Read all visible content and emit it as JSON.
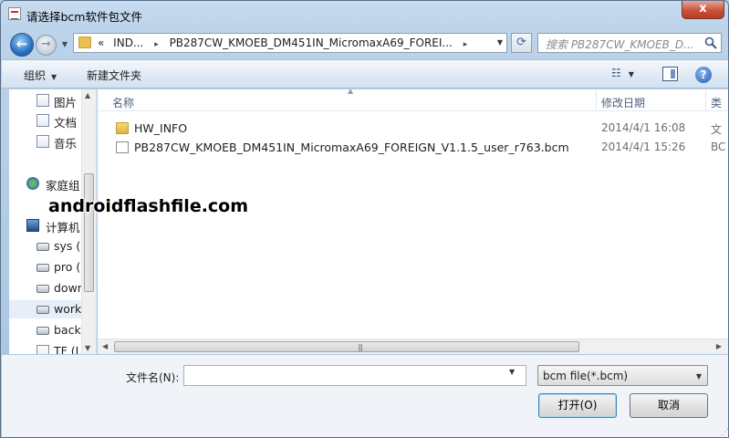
{
  "window": {
    "title": "请选择bcm软件包文件",
    "close_label": "x"
  },
  "nav": {
    "back_symbol": "←",
    "forward_symbol": "→",
    "address": {
      "overflow": "«",
      "segment1": "IND...",
      "segment2": "PB287CW_KMOEB_DM451IN_MicromaxA69_FOREI...",
      "separator": "▸"
    },
    "search_placeholder": "搜索 PB287CW_KMOEB_D..."
  },
  "toolbar": {
    "organize_label": "组织",
    "new_folder_label": "新建文件夹",
    "help_label": "?"
  },
  "sidebar": {
    "items": [
      {
        "label": "图片",
        "icon": "pictures-icon"
      },
      {
        "label": "文档",
        "icon": "documents-icon"
      },
      {
        "label": "音乐",
        "icon": "music-icon"
      },
      {
        "label": "家庭组",
        "icon": "homegroup-icon"
      },
      {
        "label": "计算机",
        "icon": "computer-icon"
      },
      {
        "label": "sys (",
        "icon": "system-drive-icon"
      },
      {
        "label": "pro (",
        "icon": "drive-icon"
      },
      {
        "label": "dowr",
        "icon": "drive-icon"
      },
      {
        "label": "work",
        "icon": "drive-icon"
      },
      {
        "label": "back",
        "icon": "drive-icon"
      },
      {
        "label": "TF (I",
        "icon": "removable-drive-icon"
      }
    ],
    "selected": "work"
  },
  "file_list": {
    "columns": [
      "名称",
      "修改日期",
      "类"
    ],
    "rows": [
      {
        "name": "HW_INFO",
        "date": "2014/4/1 16:08",
        "type": "文",
        "kind": "folder"
      },
      {
        "name": "PB287CW_KMOEB_DM451IN_MicromaxA69_FOREIGN_V1.1.5_user_r763.bcm",
        "date": "2014/4/1 15:26",
        "type": "BC",
        "kind": "file"
      }
    ]
  },
  "watermark": "androidflashfile.com",
  "footer": {
    "filename_label": "文件名(N):",
    "filename_value": "",
    "filter_value": "bcm file(*.bcm)",
    "open_label": "打开(O)",
    "cancel_label": "取消"
  }
}
